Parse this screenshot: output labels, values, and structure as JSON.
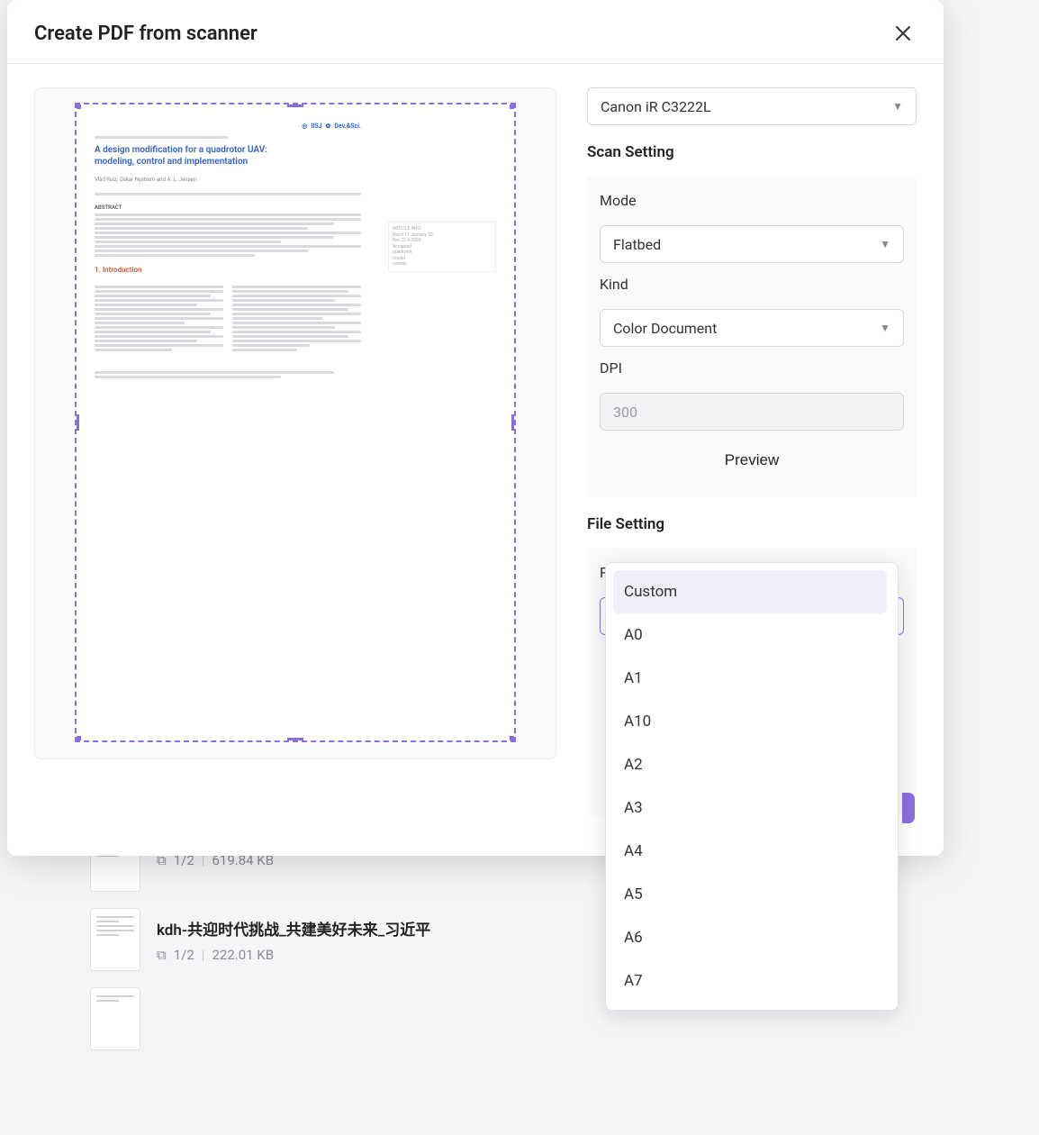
{
  "dialog": {
    "title": "Create PDF from scanner"
  },
  "scanner": {
    "selected": "Canon iR C3222L"
  },
  "scan_setting": {
    "heading": "Scan Setting",
    "mode_label": "Mode",
    "mode_value": "Flatbed",
    "kind_label": "Kind",
    "kind_value": "Color Document",
    "dpi_label": "DPI",
    "dpi_value": "300",
    "preview_btn": "Preview"
  },
  "file_setting": {
    "heading": "File Setting",
    "paper_size_label": "Paper Size",
    "paper_size_value": "Custom",
    "options": [
      "Custom",
      "A0",
      "A1",
      "A10",
      "A2",
      "A3",
      "A4",
      "A5",
      "A6",
      "A7"
    ]
  },
  "preview_doc": {
    "badge1": "IISJ",
    "badge2": "Dev.&Sci.",
    "title": "A design modification for a quadrotor UAV: modeling, control and implementation",
    "section_abstract": "ABSTRACT",
    "section_intro": "1. Introduction"
  },
  "backdrop": {
    "row1": {
      "pages": "1/2",
      "size": "619.84 KB"
    },
    "row2": {
      "name": "kdh-共迎时代挑战_共建美好未来_习近平",
      "pages": "1/2",
      "size": "222.01 KB"
    }
  }
}
